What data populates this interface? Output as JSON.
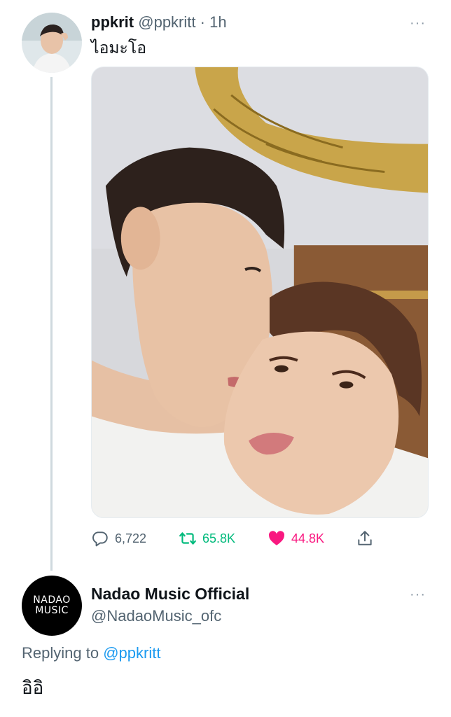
{
  "tweet": {
    "author_name": "ppkrit",
    "author_handle": "@ppkritt",
    "dot": "·",
    "time": "1h",
    "more": "···",
    "text": "ไอมะโอ",
    "stats": {
      "replies": "6,722",
      "retweets": "65.8K",
      "likes": "44.8K"
    },
    "icons": {
      "reply": "reply-icon",
      "retweet": "retweet-icon",
      "like": "heart-icon",
      "share": "share-icon"
    },
    "colors": {
      "retweet": "#00ba7c",
      "like": "#f91880",
      "muted": "#536471"
    }
  },
  "reply": {
    "author_name": "Nadao Music Official",
    "author_handle": "@NadaoMusic_ofc",
    "avatar_text_1": "NADAO",
    "avatar_text_2": "MUSIC",
    "more": "···",
    "replying_prefix": "Replying to",
    "replying_mention": "@ppkritt",
    "text": "อิอิ",
    "colors": {
      "mention": "#1d9bf0"
    }
  }
}
